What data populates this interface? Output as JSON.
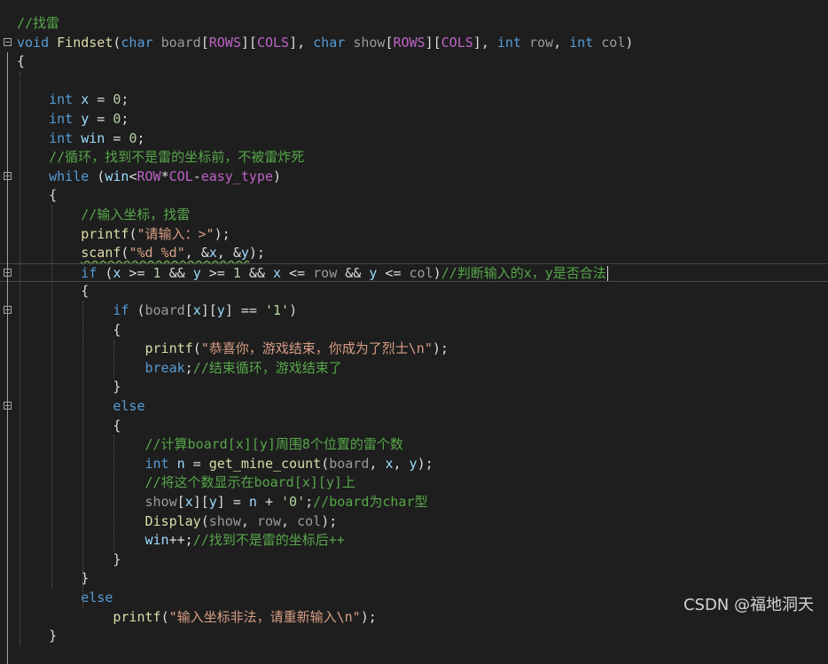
{
  "editor": {
    "lines": [
      [
        {
          "c": "cm",
          "t": "//找雷"
        }
      ],
      [
        {
          "c": "kw",
          "t": "void"
        },
        {
          "c": "pl",
          "t": " "
        },
        {
          "c": "fn",
          "t": "Findset"
        },
        {
          "c": "pl",
          "t": "("
        },
        {
          "c": "kw",
          "t": "char"
        },
        {
          "c": "pl",
          "t": " "
        },
        {
          "c": "pm",
          "t": "board"
        },
        {
          "c": "pl",
          "t": "["
        },
        {
          "c": "mc",
          "t": "ROWS"
        },
        {
          "c": "pl",
          "t": "]["
        },
        {
          "c": "mc",
          "t": "COLS"
        },
        {
          "c": "pl",
          "t": "], "
        },
        {
          "c": "kw",
          "t": "char"
        },
        {
          "c": "pl",
          "t": " "
        },
        {
          "c": "pm",
          "t": "show"
        },
        {
          "c": "pl",
          "t": "["
        },
        {
          "c": "mc",
          "t": "ROWS"
        },
        {
          "c": "pl",
          "t": "]["
        },
        {
          "c": "mc",
          "t": "COLS"
        },
        {
          "c": "pl",
          "t": "], "
        },
        {
          "c": "kw",
          "t": "int"
        },
        {
          "c": "pl",
          "t": " "
        },
        {
          "c": "pm",
          "t": "row"
        },
        {
          "c": "pl",
          "t": ", "
        },
        {
          "c": "kw",
          "t": "int"
        },
        {
          "c": "pl",
          "t": " "
        },
        {
          "c": "pm",
          "t": "col"
        },
        {
          "c": "pl",
          "t": ")"
        }
      ],
      [
        {
          "c": "pl",
          "t": "{"
        }
      ],
      [],
      [
        {
          "c": "pl",
          "t": "    "
        },
        {
          "c": "kw",
          "t": "int"
        },
        {
          "c": "pl",
          "t": " "
        },
        {
          "c": "lv",
          "t": "x"
        },
        {
          "c": "pl",
          "t": " = "
        },
        {
          "c": "nm",
          "t": "0"
        },
        {
          "c": "pl",
          "t": ";"
        }
      ],
      [
        {
          "c": "pl",
          "t": "    "
        },
        {
          "c": "kw",
          "t": "int"
        },
        {
          "c": "pl",
          "t": " "
        },
        {
          "c": "lv",
          "t": "y"
        },
        {
          "c": "pl",
          "t": " = "
        },
        {
          "c": "nm",
          "t": "0"
        },
        {
          "c": "pl",
          "t": ";"
        }
      ],
      [
        {
          "c": "pl",
          "t": "    "
        },
        {
          "c": "kw",
          "t": "int"
        },
        {
          "c": "pl",
          "t": " "
        },
        {
          "c": "lv",
          "t": "win"
        },
        {
          "c": "pl",
          "t": " = "
        },
        {
          "c": "nm",
          "t": "0"
        },
        {
          "c": "pl",
          "t": ";"
        }
      ],
      [
        {
          "c": "pl",
          "t": "    "
        },
        {
          "c": "cm",
          "t": "//循环，找到不是雷的坐标前，不被雷炸死"
        }
      ],
      [
        {
          "c": "pl",
          "t": "    "
        },
        {
          "c": "kw",
          "t": "while"
        },
        {
          "c": "pl",
          "t": " ("
        },
        {
          "c": "lv",
          "t": "win"
        },
        {
          "c": "pl",
          "t": "<"
        },
        {
          "c": "mc",
          "t": "ROW"
        },
        {
          "c": "pl",
          "t": "*"
        },
        {
          "c": "mc",
          "t": "COL"
        },
        {
          "c": "pl",
          "t": "-"
        },
        {
          "c": "mc",
          "t": "easy_type"
        },
        {
          "c": "pl",
          "t": ")"
        }
      ],
      [
        {
          "c": "pl",
          "t": "    {"
        }
      ],
      [
        {
          "c": "pl",
          "t": "        "
        },
        {
          "c": "cm",
          "t": "//输入坐标，找雷"
        }
      ],
      [
        {
          "c": "pl",
          "t": "        "
        },
        {
          "c": "fn",
          "t": "printf"
        },
        {
          "c": "pl",
          "t": "("
        },
        {
          "c": "st",
          "t": "\"请输入：>\""
        },
        {
          "c": "pl",
          "t": ");"
        }
      ],
      [
        {
          "c": "pl",
          "t": "        "
        },
        {
          "c": "fn",
          "t": "scanf",
          "s": 1
        },
        {
          "c": "pl",
          "t": "(",
          "s": 1
        },
        {
          "c": "st",
          "t": "\"%d %d\"",
          "s": 1
        },
        {
          "c": "pl",
          "t": ", &",
          "s": 1
        },
        {
          "c": "lv",
          "t": "x",
          "s": 1
        },
        {
          "c": "pl",
          "t": ", &",
          "s": 1
        },
        {
          "c": "lv",
          "t": "y",
          "s": 1
        },
        {
          "c": "pl",
          "t": ");"
        }
      ],
      [
        {
          "c": "pl",
          "t": "        "
        },
        {
          "c": "kw",
          "t": "if"
        },
        {
          "c": "pl",
          "t": " ("
        },
        {
          "c": "lv",
          "t": "x"
        },
        {
          "c": "pl",
          "t": " >= "
        },
        {
          "c": "nm",
          "t": "1"
        },
        {
          "c": "pl",
          "t": " && "
        },
        {
          "c": "lv",
          "t": "y"
        },
        {
          "c": "pl",
          "t": " >= "
        },
        {
          "c": "nm",
          "t": "1"
        },
        {
          "c": "pl",
          "t": " && "
        },
        {
          "c": "lv",
          "t": "x"
        },
        {
          "c": "pl",
          "t": " <= "
        },
        {
          "c": "pm",
          "t": "row"
        },
        {
          "c": "pl",
          "t": " && "
        },
        {
          "c": "lv",
          "t": "y"
        },
        {
          "c": "pl",
          "t": " <= "
        },
        {
          "c": "pm",
          "t": "col"
        },
        {
          "c": "pl",
          "t": ")"
        },
        {
          "c": "cm",
          "t": "//判断输入的x，y是否合法"
        }
      ],
      [
        {
          "c": "pl",
          "t": "        {"
        }
      ],
      [
        {
          "c": "pl",
          "t": "            "
        },
        {
          "c": "kw",
          "t": "if"
        },
        {
          "c": "pl",
          "t": " ("
        },
        {
          "c": "pm",
          "t": "board"
        },
        {
          "c": "pl",
          "t": "["
        },
        {
          "c": "lv",
          "t": "x"
        },
        {
          "c": "pl",
          "t": "]["
        },
        {
          "c": "lv",
          "t": "y"
        },
        {
          "c": "pl",
          "t": "] == "
        },
        {
          "c": "ct",
          "t": "'1'"
        },
        {
          "c": "pl",
          "t": ")"
        }
      ],
      [
        {
          "c": "pl",
          "t": "            {"
        }
      ],
      [
        {
          "c": "pl",
          "t": "                "
        },
        {
          "c": "fn",
          "t": "printf"
        },
        {
          "c": "pl",
          "t": "("
        },
        {
          "c": "st",
          "t": "\"恭喜你，游戏结束，你成为了烈士\\n\""
        },
        {
          "c": "pl",
          "t": ");"
        }
      ],
      [
        {
          "c": "pl",
          "t": "                "
        },
        {
          "c": "kw",
          "t": "break"
        },
        {
          "c": "pl",
          "t": ";"
        },
        {
          "c": "cm",
          "t": "//结束循环，游戏结束了"
        }
      ],
      [
        {
          "c": "pl",
          "t": "            }"
        }
      ],
      [
        {
          "c": "pl",
          "t": "            "
        },
        {
          "c": "kw",
          "t": "else"
        }
      ],
      [
        {
          "c": "pl",
          "t": "            {"
        }
      ],
      [
        {
          "c": "pl",
          "t": "                "
        },
        {
          "c": "cm",
          "t": "//计算board[x][y]周围8个位置的雷个数"
        }
      ],
      [
        {
          "c": "pl",
          "t": "                "
        },
        {
          "c": "kw",
          "t": "int"
        },
        {
          "c": "pl",
          "t": " "
        },
        {
          "c": "lv",
          "t": "n"
        },
        {
          "c": "pl",
          "t": " = "
        },
        {
          "c": "fn",
          "t": "get_mine_count"
        },
        {
          "c": "pl",
          "t": "("
        },
        {
          "c": "pm",
          "t": "board"
        },
        {
          "c": "pl",
          "t": ", "
        },
        {
          "c": "lv",
          "t": "x"
        },
        {
          "c": "pl",
          "t": ", "
        },
        {
          "c": "lv",
          "t": "y"
        },
        {
          "c": "pl",
          "t": ");"
        }
      ],
      [
        {
          "c": "pl",
          "t": "                "
        },
        {
          "c": "cm",
          "t": "//将这个数显示在board[x][y]上"
        }
      ],
      [
        {
          "c": "pl",
          "t": "                "
        },
        {
          "c": "pm",
          "t": "show"
        },
        {
          "c": "pl",
          "t": "["
        },
        {
          "c": "lv",
          "t": "x"
        },
        {
          "c": "pl",
          "t": "]["
        },
        {
          "c": "lv",
          "t": "y"
        },
        {
          "c": "pl",
          "t": "] = "
        },
        {
          "c": "lv",
          "t": "n"
        },
        {
          "c": "pl",
          "t": " + "
        },
        {
          "c": "ct",
          "t": "'0'"
        },
        {
          "c": "pl",
          "t": ";"
        },
        {
          "c": "cm",
          "t": "//board为char型"
        }
      ],
      [
        {
          "c": "pl",
          "t": "                "
        },
        {
          "c": "fn",
          "t": "Display"
        },
        {
          "c": "pl",
          "t": "("
        },
        {
          "c": "pm",
          "t": "show"
        },
        {
          "c": "pl",
          "t": ", "
        },
        {
          "c": "pm",
          "t": "row"
        },
        {
          "c": "pl",
          "t": ", "
        },
        {
          "c": "pm",
          "t": "col"
        },
        {
          "c": "pl",
          "t": ");"
        }
      ],
      [
        {
          "c": "pl",
          "t": "                "
        },
        {
          "c": "lv",
          "t": "win"
        },
        {
          "c": "pl",
          "t": "++;"
        },
        {
          "c": "cm",
          "t": "//找到不是雷的坐标后++"
        }
      ],
      [
        {
          "c": "pl",
          "t": "            }"
        }
      ],
      [
        {
          "c": "pl",
          "t": "        }"
        }
      ],
      [
        {
          "c": "pl",
          "t": "        "
        },
        {
          "c": "kw",
          "t": "else"
        }
      ],
      [
        {
          "c": "pl",
          "t": "            "
        },
        {
          "c": "fn",
          "t": "printf"
        },
        {
          "c": "pl",
          "t": "("
        },
        {
          "c": "st",
          "t": "\"输入坐标非法，请重新输入\\n\""
        },
        {
          "c": "pl",
          "t": ");"
        }
      ],
      [
        {
          "c": "pl",
          "t": "    }"
        }
      ]
    ],
    "fold_lines": [
      1,
      8,
      13,
      15,
      20
    ],
    "current_line": 13
  },
  "watermark": "CSDN @福地洞天",
  "colors": {
    "background": "#1e1e1e",
    "keyword": "#569cd6",
    "comment": "#57a64a",
    "function": "#dcdcaa",
    "string": "#d69d85",
    "macro": "#bd63c5",
    "local": "#9cdcfe",
    "param": "#9a9a9a",
    "number": "#b5cea8"
  }
}
